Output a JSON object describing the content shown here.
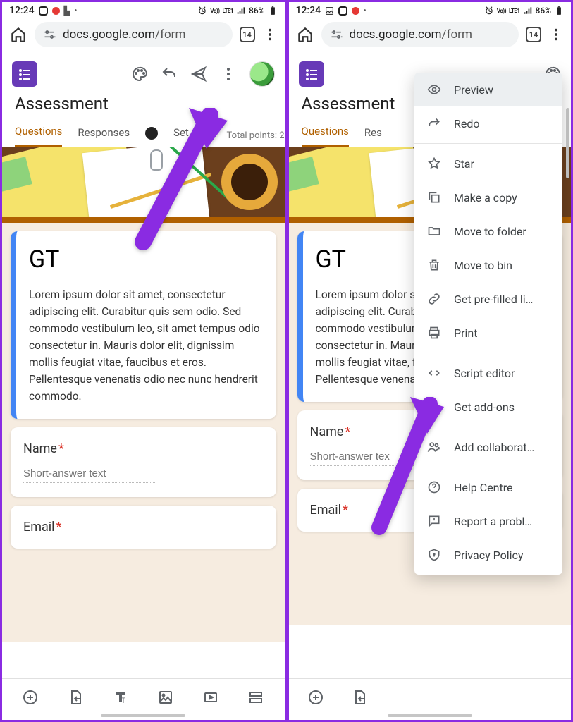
{
  "status": {
    "time": "12:24",
    "battery": "86%",
    "net_label": "Vo))",
    "lte": "LTE1"
  },
  "chrome": {
    "url_prefix": "docs.google.com",
    "url_suffix": "/form",
    "tab_count": "14"
  },
  "appbar": {
    "title": "Assessment"
  },
  "tabs": {
    "questions": "Questions",
    "responses": "Responses",
    "settings_truncated": "Set",
    "responses_truncated": "Res",
    "total_points": "Total points: 2"
  },
  "form": {
    "header_title": "GT",
    "header_desc": "Lorem ipsum dolor sit amet, consectetur adipiscing elit. Curabitur quis sem odio. Sed commodo vestibulum leo, sit amet tempus odio consectetur in. Mauris dolor elit, dignissim mollis feugiat vitae, faucibus et eros. Pellentesque venenatis odio nec nunc hendrerit commodo.",
    "header_desc_truncated": "Lorem ipsum dolor sit amet, consectetur adipiscing elit. Curabitur quis sem odio. Sed commodo vestibulum leo, sit amet tempus odio consectetur in. Mauris dolor elit, dignissim mollis feugiat vitae, faucibus et eros. Pellentesque venenatis odio nec nunc",
    "q1_label": "Name",
    "q2_label": "Email",
    "short_placeholder": "Short-answer text",
    "short_placeholder_trunc": "Short-answer tex"
  },
  "menu": {
    "preview": "Preview",
    "redo": "Redo",
    "star": "Star",
    "copy": "Make a copy",
    "move": "Move to folder",
    "bin": "Move to bin",
    "prefill": "Get pre-filled li…",
    "print": "Print",
    "script": "Script editor",
    "addons": "Get add-ons",
    "collab": "Add collaborat…",
    "help": "Help Centre",
    "report": "Report a probl…",
    "privacy": "Privacy Policy"
  }
}
